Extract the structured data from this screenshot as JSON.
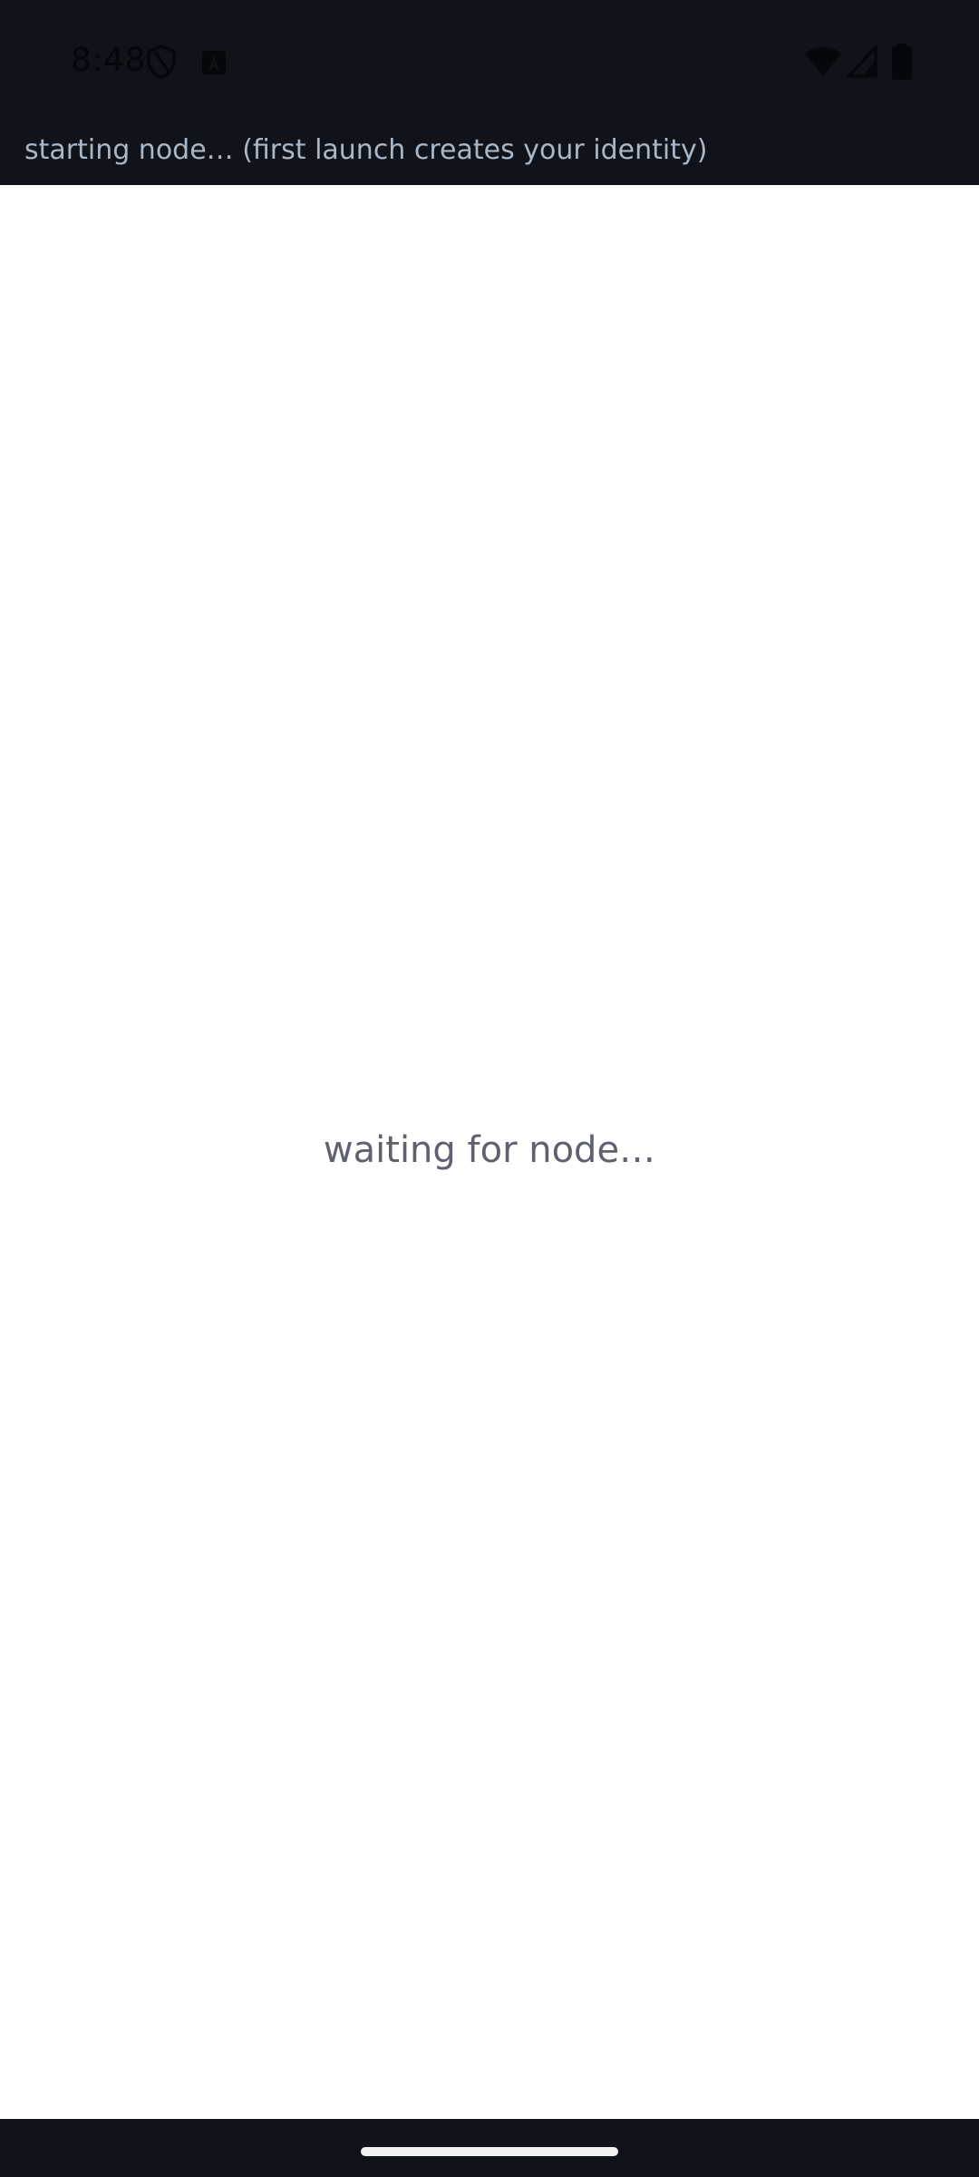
{
  "status_bar": {
    "time": "8:48",
    "icons": [
      "shield-icon",
      "notification-a-icon",
      "wifi-icon",
      "cellular-signal-icon",
      "battery-icon"
    ]
  },
  "banner": {
    "text": "starting node… (first launch creates your identity)"
  },
  "main": {
    "waiting_text": "waiting for node…"
  },
  "colors": {
    "top_background": "#10131a",
    "banner_text": "#a9b6c6",
    "waiting_text": "#60616f",
    "page_background": "#ffffff"
  }
}
